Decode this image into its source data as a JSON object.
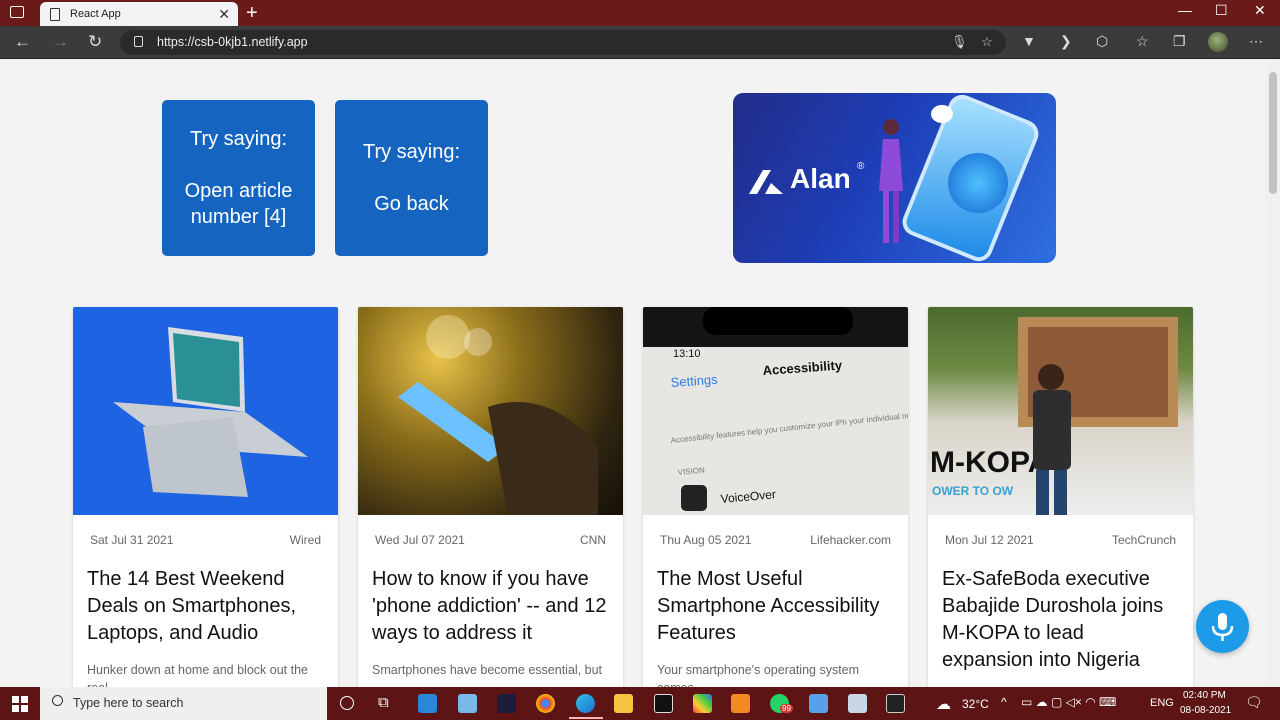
{
  "browser": {
    "tab_title": "React App",
    "tab_close": "✕",
    "new_tab": "+",
    "url": "https://csb-0kjb1.netlify.app",
    "window_controls": [
      "—",
      "☐",
      "✕"
    ]
  },
  "hints": [
    {
      "line1": "Try saying:",
      "line2": "Open article number [4]"
    },
    {
      "line1": "Try saying:",
      "line2": "Go back"
    }
  ],
  "banner": {
    "brand": "Alan",
    "registered": "®"
  },
  "articles": [
    {
      "date": "Sat Jul 31 2021",
      "source": "Wired",
      "title": "The 14 Best Weekend Deals on Smartphones, Laptops, and Audio",
      "description": "Hunker down at home and block out the real"
    },
    {
      "date": "Wed Jul 07 2021",
      "source": "CNN",
      "title": "How to know if you have 'phone addiction' -- and 12 ways to address it",
      "description": "Smartphones have become essential, but"
    },
    {
      "date": "Thu Aug 05 2021",
      "source": "Lifehacker.com",
      "title": "The Most Useful Smartphone Accessibility Features",
      "description": "Your smartphone's operating system comes"
    },
    {
      "date": "Mon Jul 12 2021",
      "source": "TechCrunch",
      "title": "Ex-SafeBoda executive Babajide Duroshola joins M-KOPA to lead expansion into Nigeria",
      "description": ""
    }
  ],
  "image_text": {
    "phone_time": "13:10",
    "settings_back": "Settings",
    "accessibility": "Accessibility",
    "access_desc": "Accessibility features help you customize your iPh your individual needs.",
    "vision": "VISION",
    "voiceover": "VoiceOver",
    "mkopa": "M-KOPA",
    "mkopa_tag": "OWER TO OW"
  },
  "taskbar": {
    "search_placeholder": "Type here to search",
    "weather": "32°C",
    "lang": "ENG",
    "time": "02:40 PM",
    "date": "08-08-2021",
    "whatsapp_badge": "99"
  },
  "colors": {
    "hint_bg": "#1565c0",
    "tabbar": "#6b1a1a",
    "taskbar": "#5c1414",
    "mic_fab": "#1e9be8"
  }
}
